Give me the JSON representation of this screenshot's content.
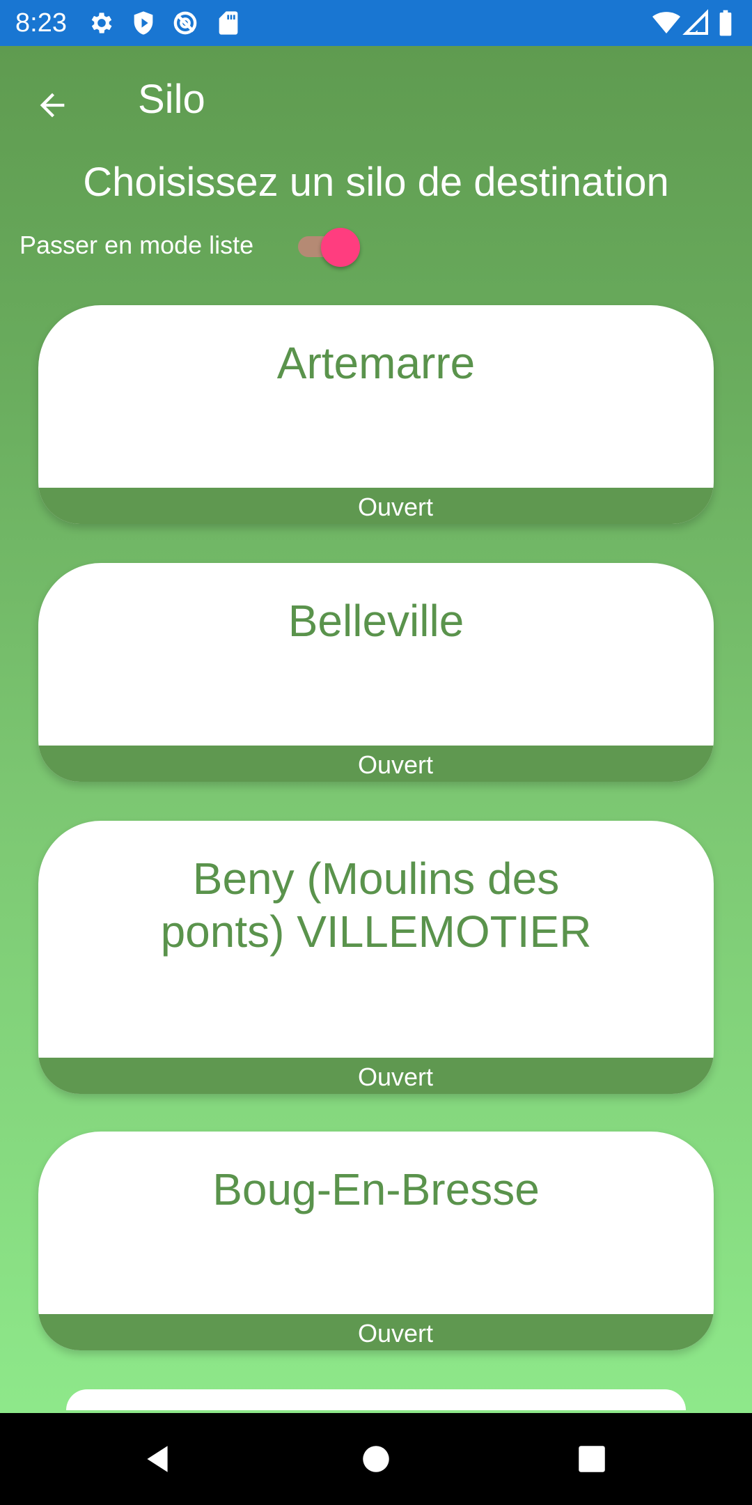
{
  "status_bar": {
    "time": "8:23",
    "left_icons": [
      "gear-icon",
      "shield-icon",
      "vpn-icon",
      "sd-card-icon"
    ],
    "right_icons": [
      "wifi-icon",
      "signal-icon",
      "battery-icon"
    ],
    "color": "#1976d2"
  },
  "toolbar": {
    "title": "Silo",
    "back_icon": "arrow-back-icon"
  },
  "heading": "Choisissez un silo de destination",
  "list_mode_toggle": {
    "label": "Passer en mode liste",
    "checked": true,
    "thumb_color": "#ff3d7f"
  },
  "silos": [
    {
      "name": "Artemarre",
      "status": "Ouvert"
    },
    {
      "name": "Belleville",
      "status": "Ouvert"
    },
    {
      "name": "Beny (Moulins des ponts) VILLEMOTIER",
      "status": "Ouvert"
    },
    {
      "name": "Boug-En-Bresse",
      "status": "Ouvert"
    }
  ],
  "colors": {
    "accent_green": "#5f9850",
    "card_text": "#5a934c",
    "background_top": "#5f9b50",
    "background_bottom": "#8ee88a"
  },
  "nav_bar": {
    "icons": [
      "back-triangle-icon",
      "home-circle-icon",
      "recents-square-icon"
    ]
  }
}
